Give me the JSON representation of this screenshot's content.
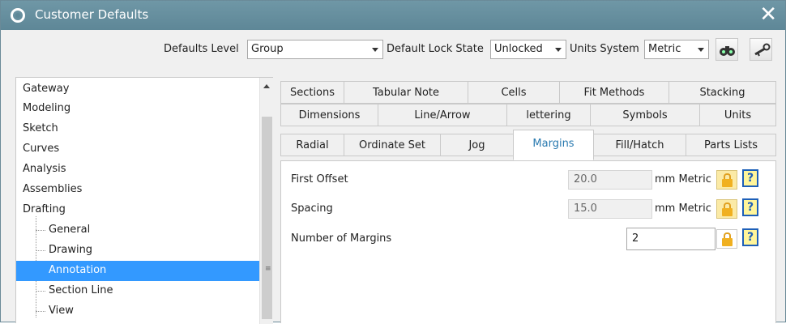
{
  "window": {
    "title": "Customer Defaults",
    "close_glyph": "✕"
  },
  "toolbar": {
    "defaults_level_label": "Defaults Level",
    "defaults_level_value": "Group",
    "lock_state_label": "Default Lock State",
    "lock_state_value": "Unlocked",
    "units_label": "Units System",
    "units_value": "Metric"
  },
  "tree": {
    "items": [
      {
        "label": "Gateway"
      },
      {
        "label": "Modeling"
      },
      {
        "label": "Sketch"
      },
      {
        "label": "Curves"
      },
      {
        "label": "Analysis"
      },
      {
        "label": "Assemblies"
      },
      {
        "label": "Drafting"
      },
      {
        "label": "General"
      },
      {
        "label": "Drawing"
      },
      {
        "label": "Annotation"
      },
      {
        "label": "Section Line"
      },
      {
        "label": "View"
      }
    ],
    "selected": "Annotation",
    "grip_glyph": "≡"
  },
  "tabs": {
    "row1": [
      "Sections",
      "Tabular Note",
      "Cells",
      "Fit Methods",
      "Stacking"
    ],
    "row2": [
      "Dimensions",
      "Line/Arrow",
      "lettering",
      "Symbols",
      "Units"
    ],
    "row3": [
      "Radial",
      "Ordinate Set",
      "Jog",
      "Margins",
      "Fill/Hatch",
      "Parts Lists"
    ],
    "active": "Margins"
  },
  "margins": {
    "first_offset": {
      "label": "First Offset",
      "value": "20.0",
      "unit": "mm Metric"
    },
    "spacing": {
      "label": "Spacing",
      "value": "15.0",
      "unit": "mm Metric"
    },
    "number_of_margins": {
      "label": "Number of Margins",
      "value": "2"
    },
    "help_glyph": "?"
  },
  "icons": {
    "title": "gear-icon",
    "toolbar_buttons": [
      "binoculars-icon",
      "key-icon"
    ],
    "lock": "lock-icon",
    "help": "help-icon"
  },
  "colors": {
    "titlebar": "#5e8797",
    "selection": "#3399ff",
    "active_tab_text": "#2a7ab0",
    "lock_bg": "#fbeaa6"
  }
}
